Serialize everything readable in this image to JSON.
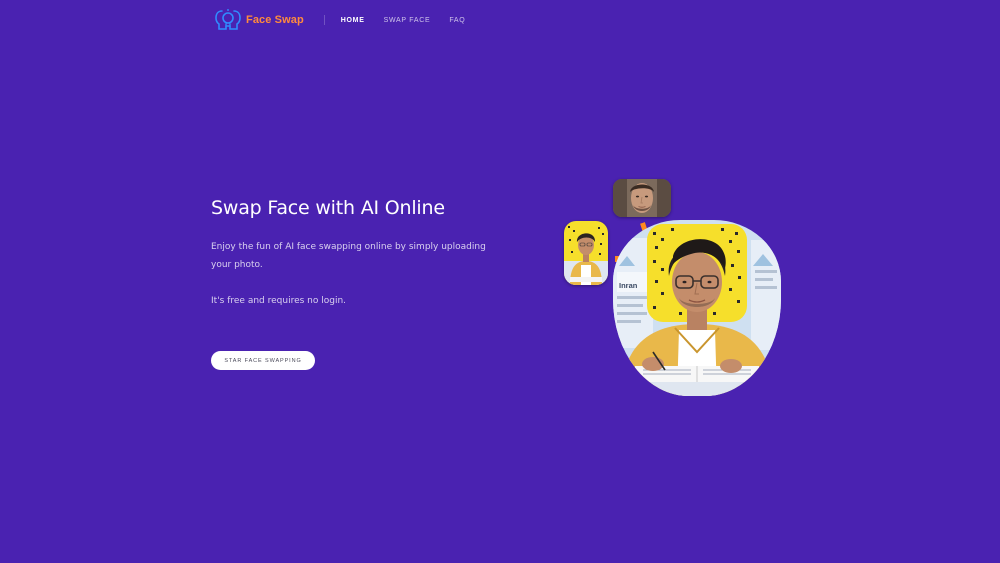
{
  "nav": {
    "brand": "Face Swap",
    "links": [
      {
        "label": "HOME",
        "active": true
      },
      {
        "label": "SWAP FACE",
        "active": false
      },
      {
        "label": "FAQ",
        "active": false
      }
    ]
  },
  "hero": {
    "title": "Swap Face with AI Online",
    "description": "Enjoy the fun of AI face swapping online by simply uploading your photo.",
    "note": "It's free and requires no login.",
    "cta_label": "STAR FACE SWAPPING"
  },
  "illustration": {
    "screen_text": "Inran"
  },
  "icons": {
    "brand": "brain-face-icon",
    "arrows": "arrow-icon"
  },
  "colors": {
    "background": "#4a22b1",
    "brand_accent": "#ff8a3d",
    "cta_bg": "#ffffff",
    "arrow": "#ff8a1f",
    "photo_yellow": "#f6df2b"
  }
}
